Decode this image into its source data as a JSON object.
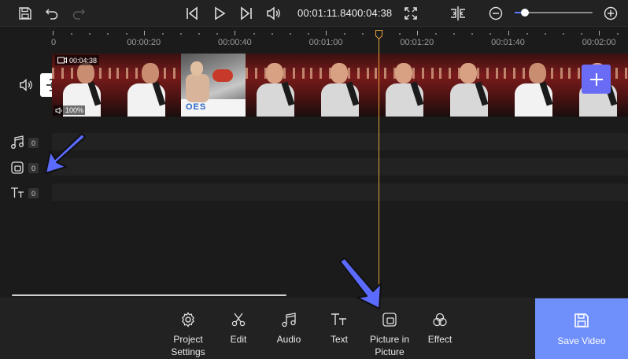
{
  "toolbar": {
    "icons": [
      "save-icon",
      "undo-icon",
      "redo-icon",
      "skip-to-start-icon",
      "play-icon",
      "skip-to-end-icon",
      "volume-icon",
      "fullscreen-icon",
      "split-icon",
      "zoom-out-icon",
      "zoom-in-icon"
    ],
    "timecode": "00:01:11.8400:04:38",
    "zoom_level": 0.13
  },
  "ruler": {
    "labels": [
      "0",
      "00:00:20",
      "00:00:40",
      "00:01:00",
      "00:01:20",
      "00:01:40",
      "00:02:00"
    ]
  },
  "video_track": {
    "duration": "00:04:38",
    "volume": "100%",
    "icons": [
      "camera-icon",
      "speaker-icon",
      "add-icon",
      "detach-audio-icon"
    ]
  },
  "tracks": [
    {
      "name": "music",
      "icon": "music-icon",
      "count": "0"
    },
    {
      "name": "picture-in-picture",
      "icon": "picture-in-picture-icon",
      "count": "0"
    },
    {
      "name": "text",
      "icon": "text-icon",
      "count": "0"
    }
  ],
  "bottom_tools": [
    {
      "label": "Project Settings",
      "icon": "gear-icon"
    },
    {
      "label": "Edit",
      "icon": "scissors-icon"
    },
    {
      "label": "Audio",
      "icon": "music-icon"
    },
    {
      "label": "Text",
      "icon": "text-icon"
    },
    {
      "label": "Picture in Picture",
      "icon": "picture-in-picture-icon"
    },
    {
      "label": "Effect",
      "icon": "effect-icon"
    }
  ],
  "save_video": {
    "label": "Save Video",
    "icon": "save-icon"
  },
  "colors": {
    "accent": "#6f8ffb",
    "add_button": "#6b6cf5",
    "playhead": "#e6a23a",
    "guide_arrow": "#5b6bff"
  }
}
